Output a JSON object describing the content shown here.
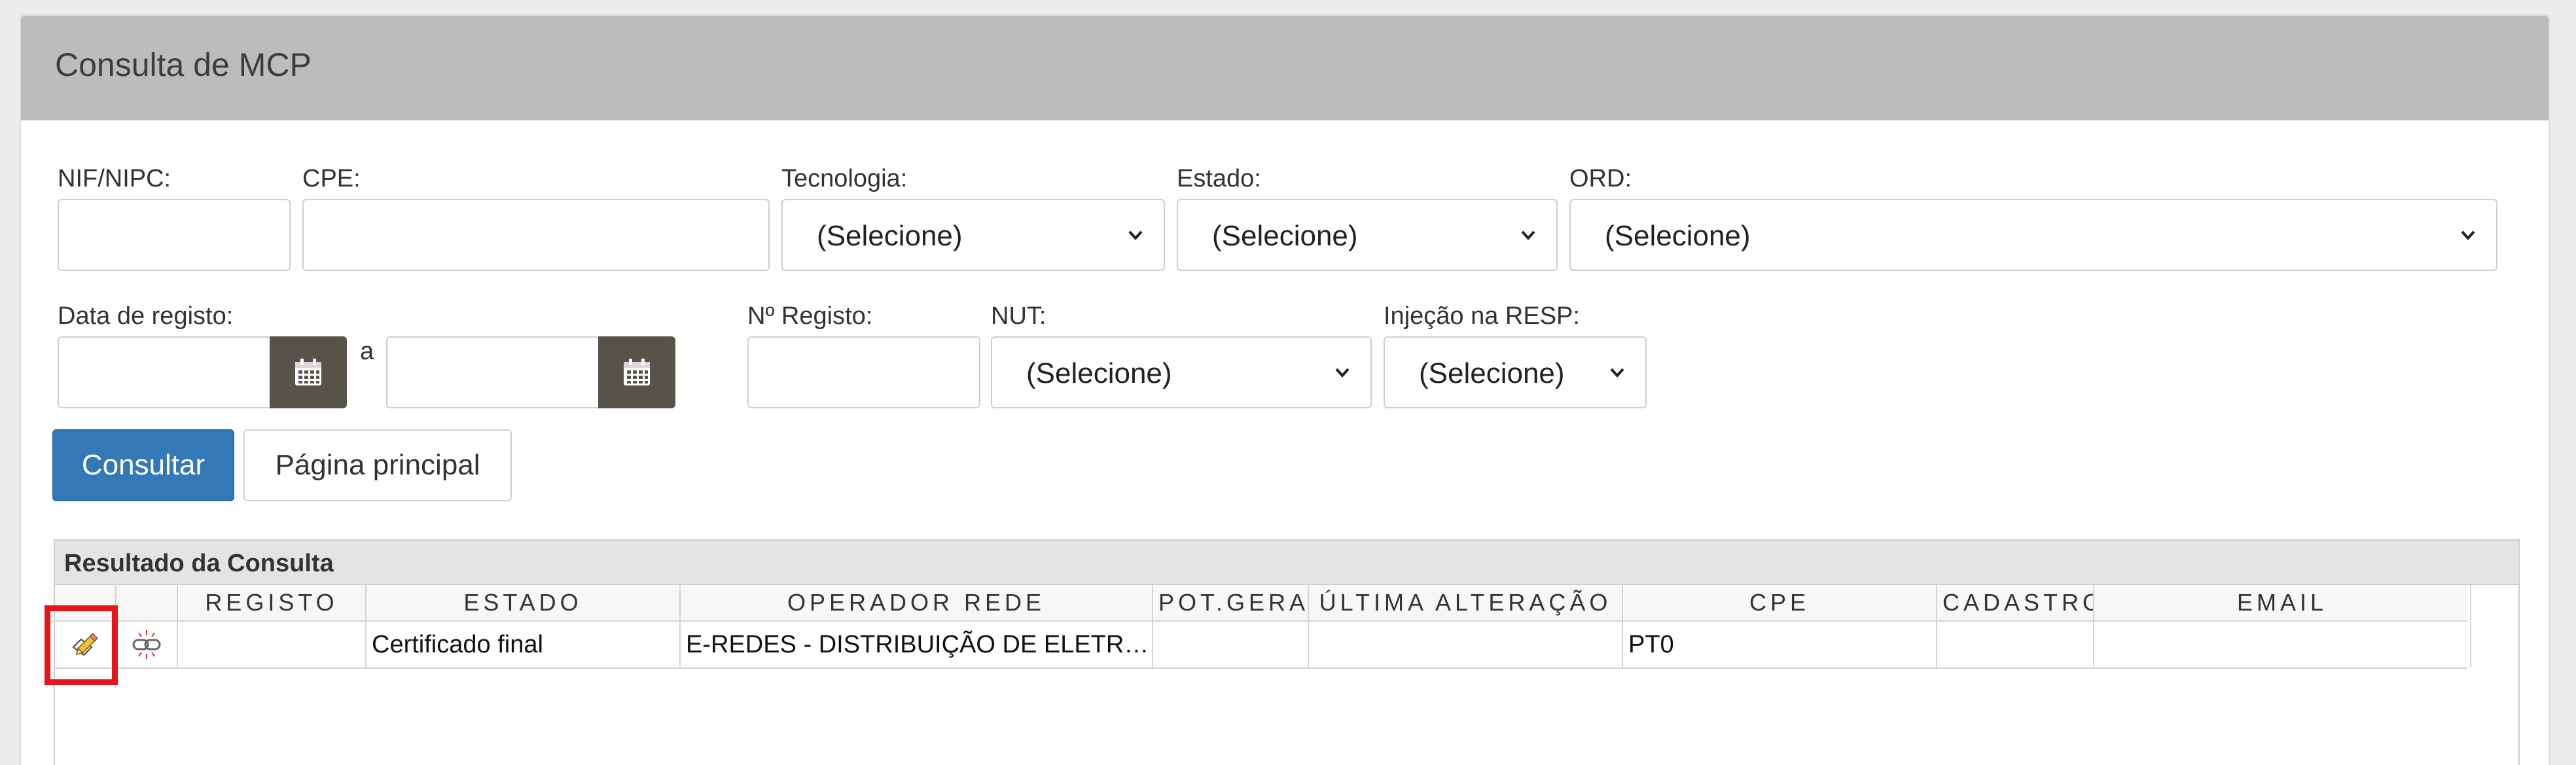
{
  "page": {
    "title": "Consulta de MCP"
  },
  "filters": {
    "nif_label": "NIF/NIPC:",
    "nif_value": "",
    "cpe_label": "CPE:",
    "cpe_value": "",
    "tecnologia_label": "Tecnologia:",
    "tecnologia_value": "(Selecione)",
    "estado_label": "Estado:",
    "estado_value": "(Selecione)",
    "ord_label": "ORD:",
    "ord_value": "(Selecione)",
    "data_registo_label": "Data de registo:",
    "data_from_value": "",
    "data_separator": "a",
    "data_to_value": "",
    "n_registo_label": "Nº Registo:",
    "n_registo_value": "",
    "nut_label": "NUT:",
    "nut_value": "(Selecione)",
    "injecao_label": "Injeção na RESP:",
    "injecao_value": "(Selecione)"
  },
  "actions": {
    "consultar_label": "Consultar",
    "pagina_principal_label": "Página principal"
  },
  "results": {
    "caption": "Resultado da Consulta",
    "columns": [
      "",
      "",
      "REGISTO",
      "ESTADO",
      "OPERADOR REDE",
      "POT.GERADORA",
      "ÚLTIMA ALTERAÇÃO",
      "CPE",
      "CADASTRO",
      "EMAIL"
    ],
    "rows": [
      {
        "edit_icon": "pencil-edit-icon",
        "link_icon": "broken-link-icon",
        "registo": "",
        "estado": "Certificado final",
        "operador_rede": "E-REDES - DISTRIBUIÇÃO DE ELETRICIDADE, S.A.",
        "pot_geradora": "",
        "ultima_alteracao": "",
        "cpe": "PT0",
        "cadastro": "",
        "email": ""
      }
    ]
  },
  "colors": {
    "header_bg": "#bcbcbc",
    "primary_button": "#3479b7",
    "calendar_button": "#575349",
    "highlight": "#e8141b"
  }
}
